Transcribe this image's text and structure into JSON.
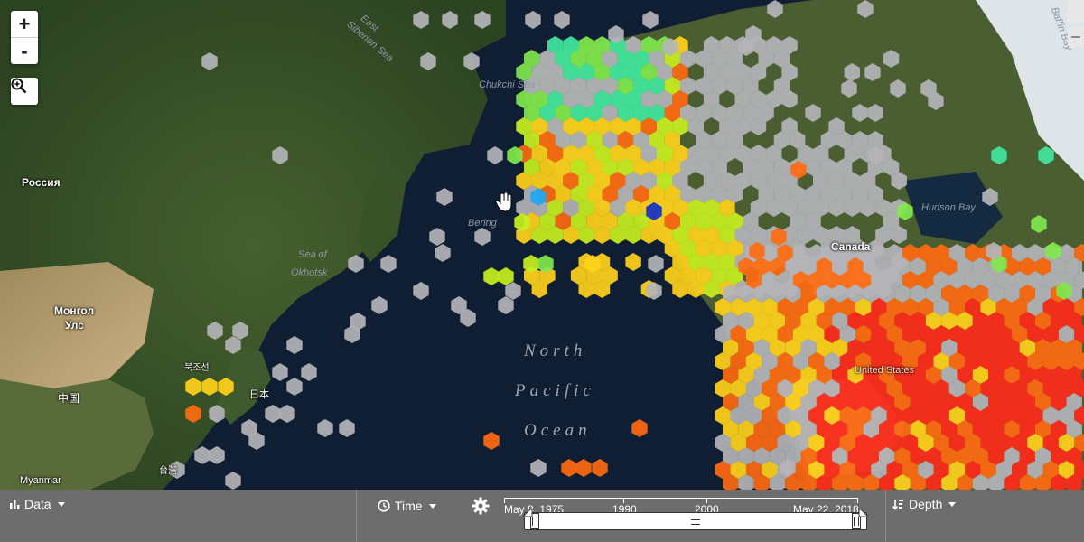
{
  "map": {
    "zoom_in": "+",
    "zoom_out": "-",
    "labels": {
      "russia": "Россия",
      "mongolia_1": "Монгол",
      "mongolia_2": "Улс",
      "china": "中国",
      "north_korea": "북조선",
      "japan": "日本",
      "taiwan": "台灣",
      "myanmar": "Myanmar",
      "canada": "Canada",
      "east_siberian_1": "East",
      "east_siberian_2": "Siberian Sea",
      "chukchi": "Chukchi Sea",
      "bering": "Bering",
      "okhotsk_1": "Sea of",
      "okhotsk_2": "Okhotsk",
      "hudson": "Hudson Bay",
      "baffin": "Baffin Bay",
      "ocean_1": "North",
      "ocean_2": "Pacific",
      "ocean_3": "Ocean",
      "states": "United States"
    },
    "colors": {
      "gray": "#b4b4b8",
      "red": "#ff2a1a",
      "orange": "#ff6a10",
      "yellow": "#ffd21a",
      "lime": "#c8f020",
      "green": "#80e84c",
      "teal": "#40e8a0",
      "blue": "#1030c8",
      "cyan": "#20a8f0"
    }
  },
  "bar": {
    "data_label": "Data",
    "time_label": "Time",
    "depth_label": "Depth",
    "timeline": {
      "start": "May 8, 1975",
      "t1990": "1990",
      "t2000": "2000",
      "end": "May 22, 2018"
    }
  }
}
